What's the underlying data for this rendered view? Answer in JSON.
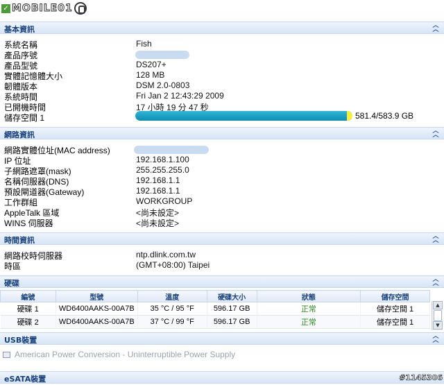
{
  "logo": {
    "text": "MOBILE01"
  },
  "sections": {
    "basic": {
      "title": "基本資訊",
      "rows": [
        {
          "label": "系統名稱",
          "value": "Fish"
        },
        {
          "label": "產品序號",
          "value": ""
        },
        {
          "label": "產品型號",
          "value": "DS207+"
        },
        {
          "label": "實體記憶體大小",
          "value": "128 MB"
        },
        {
          "label": "韌體版本",
          "value": "DSM 2.0-0803"
        },
        {
          "label": "系統時間",
          "value": "Fri Jan 2 12:43:29 2009"
        },
        {
          "label": "已開機時間",
          "value": "17 小時 19 分 47 秒"
        },
        {
          "label": "儲存空間 1",
          "value": "581.4/583.9 GB"
        }
      ],
      "storage_fraction": 0.9957
    },
    "network": {
      "title": "網路資訊",
      "rows": [
        {
          "label": "網路實體位址(MAC address)",
          "value": ""
        },
        {
          "label": "IP 位址",
          "value": "192.168.1.100"
        },
        {
          "label": "子網路遮罩(mask)",
          "value": "255.255.255.0"
        },
        {
          "label": "名稱伺服器(DNS)",
          "value": "192.168.1.1"
        },
        {
          "label": "預設閘道器(Gateway)",
          "value": "192.168.1.1"
        },
        {
          "label": "工作群組",
          "value": "WORKGROUP"
        },
        {
          "label": "AppleTalk 區域",
          "value": "<尚未設定>"
        },
        {
          "label": "WINS 伺服器",
          "value": "<尚未設定>"
        }
      ]
    },
    "time": {
      "title": "時間資訊",
      "rows": [
        {
          "label": "網路校時伺服器",
          "value": "ntp.dlink.com.tw"
        },
        {
          "label": "時區",
          "value": "(GMT+08:00) Taipei"
        }
      ]
    },
    "disks": {
      "title": "硬碟",
      "columns": [
        "編號",
        "型號",
        "溫度",
        "硬碟大小",
        "狀態",
        "儲存空間"
      ],
      "rows": [
        [
          "硬碟 1",
          "WD6400AAKS-00A7B",
          "35 °C / 95 °F",
          "596.17 GB",
          "正常",
          "儲存空間 1"
        ],
        [
          "硬碟 2",
          "WD6400AAKS-00A7B",
          "37 °C / 99 °F",
          "596.17 GB",
          "正常",
          "儲存空間 1"
        ]
      ]
    },
    "usb": {
      "title": "USB裝置",
      "items": [
        "American Power Conversion - Uninterruptible Power Supply"
      ]
    },
    "esata": {
      "title": "eSATA裝置"
    }
  },
  "watermark": "#1145306",
  "colors": {
    "accent": "#17407a",
    "bar": "#1a9fc4",
    "ok": "#2d8a1e"
  }
}
